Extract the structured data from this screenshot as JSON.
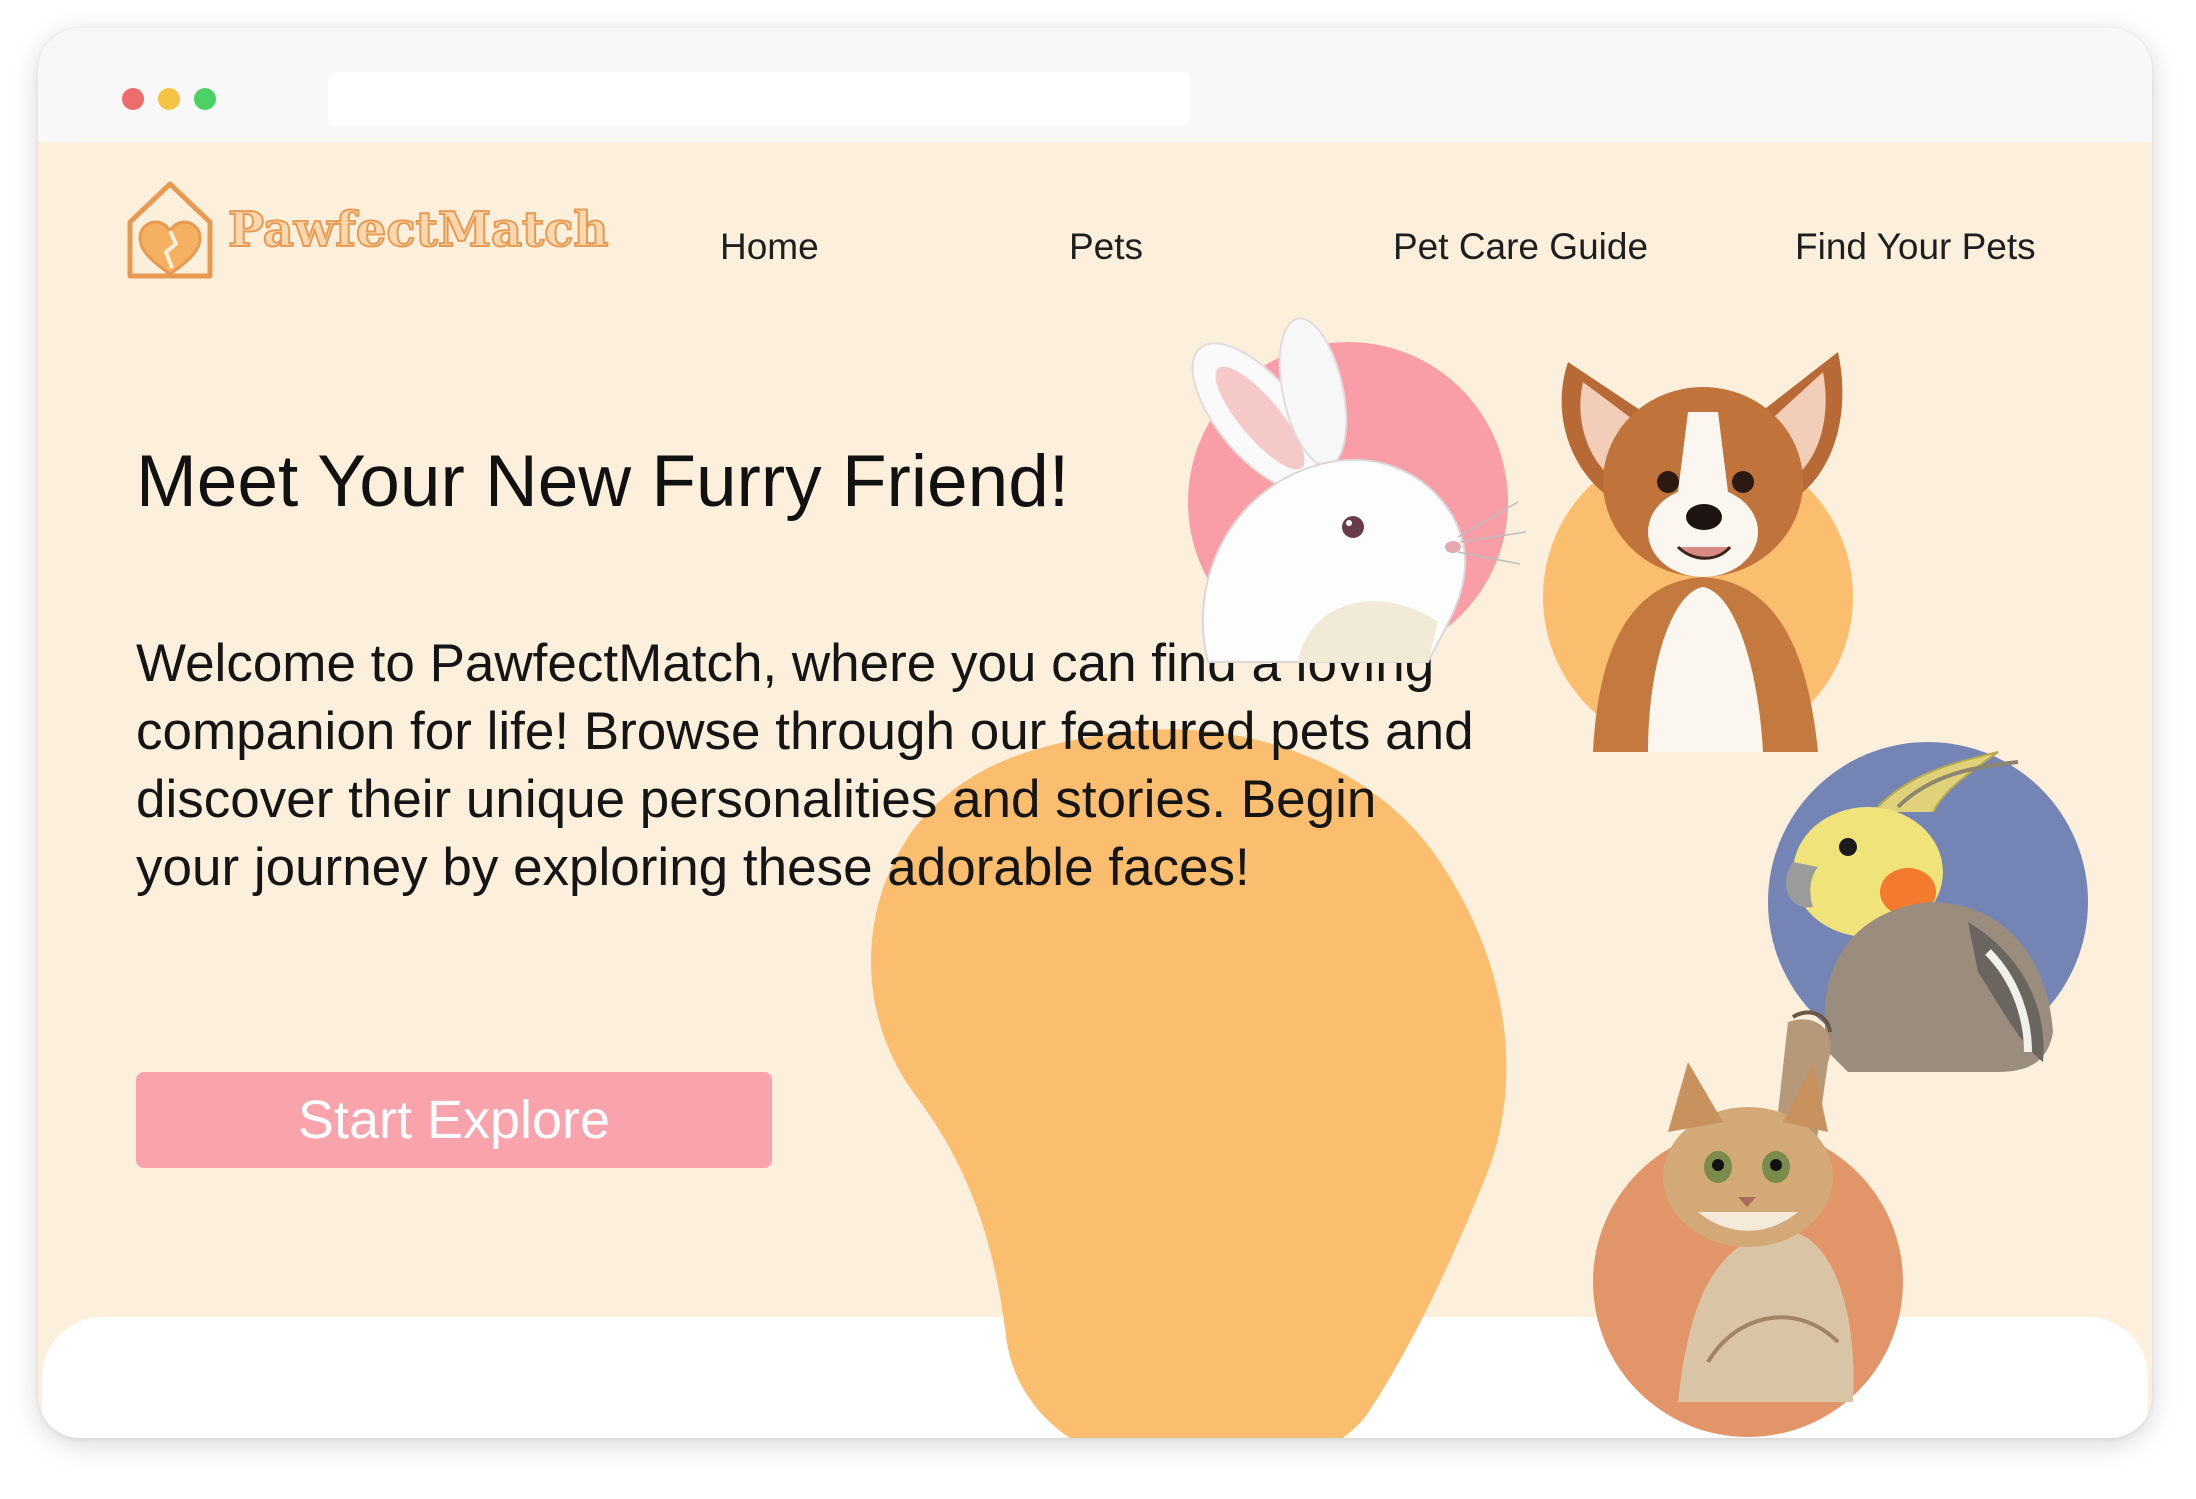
{
  "window": {
    "traffic_lights": [
      "#ee6b6e",
      "#f6c445",
      "#4ed164"
    ],
    "address_bar_text": ""
  },
  "brand": {
    "name": "PawfectMatch",
    "icon": "house-heart-icon",
    "color": "#e79b52"
  },
  "nav": {
    "items": [
      {
        "label": "Home"
      },
      {
        "label": "Pets"
      },
      {
        "label": "Pet Care Guide"
      },
      {
        "label": "Find Your Pets"
      }
    ]
  },
  "hero": {
    "title": "Meet Your New Furry Friend!",
    "description": "Welcome to PawfectMatch, where you can find a loving companion for life! Browse through our featured pets and discover their unique personalities and stories. Begin your journey by exploring these adorable faces!",
    "cta_label": "Start Explore"
  },
  "pets": [
    {
      "animal": "rabbit",
      "icon": "rabbit-icon",
      "circle_color": "#f99da7"
    },
    {
      "animal": "dog",
      "icon": "corgi-puppy-icon",
      "circle_color": "#fbbd6e"
    },
    {
      "animal": "bird",
      "icon": "cockatiel-icon",
      "circle_color": "#7384b5"
    },
    {
      "animal": "cat",
      "icon": "kitten-icon",
      "circle_color": "#e3956a"
    }
  ],
  "colors": {
    "page_background": "#fcefdc",
    "blob": "#fbbd6e",
    "cta_background": "#f9a3ad",
    "text": "#151515"
  }
}
